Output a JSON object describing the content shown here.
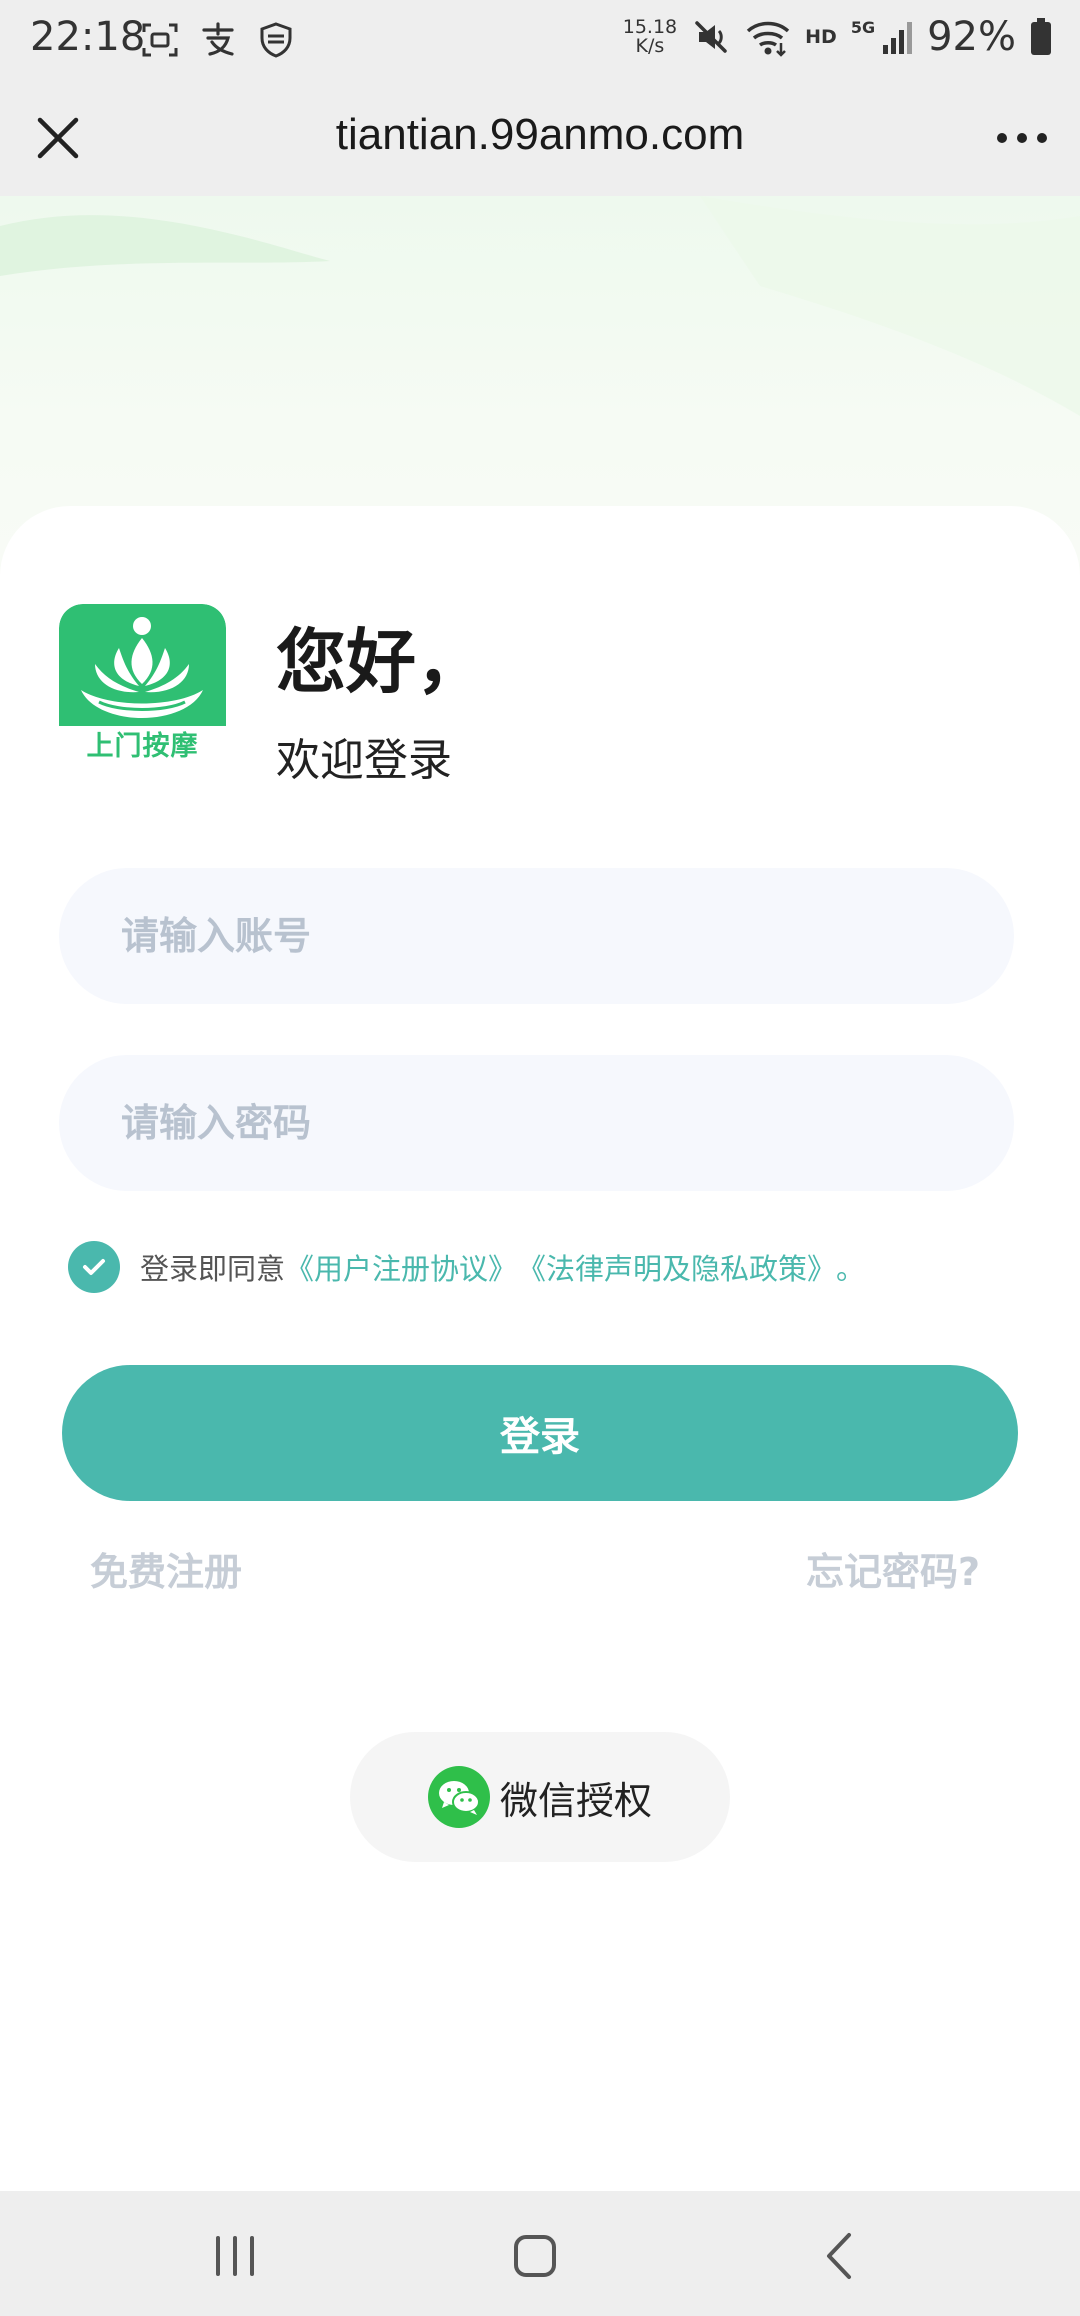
{
  "status_bar": {
    "time": "22:18",
    "net_speed_value": "15.18",
    "net_speed_unit": "K/s",
    "hd": "HD",
    "network": "5G",
    "battery": "92%"
  },
  "browser": {
    "url": "tiantian.99anmo.com"
  },
  "logo": {
    "text": "上门按摩"
  },
  "greeting": {
    "title": "您好，",
    "subtitle": "欢迎登录"
  },
  "form": {
    "account_placeholder": "请输入账号",
    "password_placeholder": "请输入密码",
    "account_value": "",
    "password_value": ""
  },
  "agreement": {
    "prefix": "登录即同意",
    "user_agreement": "《用户注册协议》",
    "privacy_policy": "《法律声明及隐私政策》",
    "suffix": "。",
    "checked": true
  },
  "actions": {
    "login_label": "登录",
    "register_label": "免费注册",
    "forgot_label": "忘记密码?",
    "wechat_label": "微信授权"
  },
  "colors": {
    "accent": "#4ab8ad",
    "brand_green": "#2fbf73",
    "wechat_green": "#2fbf4a"
  }
}
